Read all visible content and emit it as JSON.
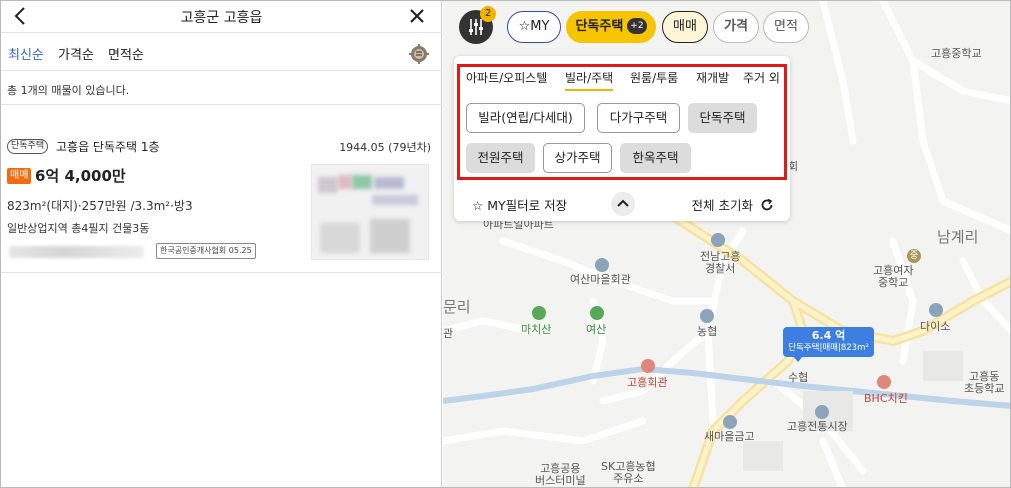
{
  "header": {
    "title": "고흥군 고흥읍"
  },
  "sort": {
    "options": [
      "최신순",
      "가격순",
      "면적순"
    ],
    "active": "최신순"
  },
  "count_text": "총 1개의 매물이 있습니다.",
  "listing": {
    "type_badge": "단독주택",
    "name": "고흥읍 단독주택 1층",
    "built": "1944.05 (79년차)",
    "deal_badge": "매매",
    "price": "6억 4,000만",
    "spec": "823m²(대지)·257만원 /3.3m²·방3",
    "zone": "일반상업지역 총4필지 건물3동",
    "agency": "한국공인중개사협회 05.25"
  },
  "filter_bar": {
    "badge_count": "2",
    "my_label": "MY",
    "type_label": "단독주택",
    "type_extra": "+2",
    "deal_label": "매매",
    "price_label": "가격",
    "area_label": "면적"
  },
  "dropdown": {
    "tabs": [
      "아파트/오피스텔",
      "빌라/주택",
      "원룸/투룸",
      "재개발",
      "주거 외"
    ],
    "active_tab": "빌라/주택",
    "options": [
      {
        "label": "빌라(연립/다세대)",
        "selected": false
      },
      {
        "label": "다가구주택",
        "selected": false
      },
      {
        "label": "단독주택",
        "selected": true
      },
      {
        "label": "전원주택",
        "selected": true
      },
      {
        "label": "상가주택",
        "selected": false
      },
      {
        "label": "한옥주택",
        "selected": true
      }
    ],
    "save_label": "MY필터로 저장",
    "reset_label": "전체 초기화"
  },
  "map": {
    "marker": {
      "price": "6.4 억",
      "desc": "단독주택|매매|823m²"
    },
    "labels": {
      "school1": "고흥중학교",
      "namgye": "남계리",
      "hoeui": "회",
      "school2": "고흥여자\n중학교",
      "school_badge": "중",
      "police": "전남고흥\n경찰서",
      "apt": "아파트일아파트",
      "yeosan_hall": "여산마을회관",
      "munri": "문리",
      "gwan": "관",
      "machisan": "마치산",
      "yeosan": "여산",
      "nonghyup": "농협",
      "daiso": "다이소",
      "suhyup": "수협",
      "goheung_hall": "고흥회관",
      "bhc": "BHC치킨",
      "goheungdong": "고흥동\n초등학교",
      "market": "고흥전통시장",
      "saemaeul": "새마을금고",
      "bus": "고흥공용\n버스터미널",
      "sk": "SK고흥농협\n주유소"
    }
  },
  "colors": {
    "accent_yellow": "#f6c400",
    "deal_orange": "#f26b10",
    "marker_blue": "#3d7fe0",
    "highlight_red": "#e11919",
    "sort_active_blue": "#3a66c8"
  }
}
